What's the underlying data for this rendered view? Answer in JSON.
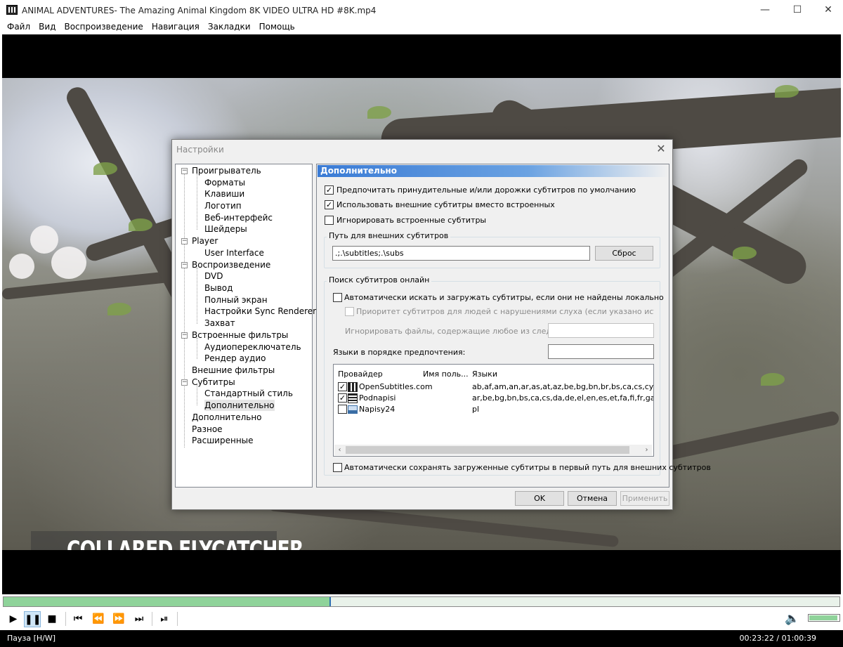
{
  "window": {
    "title": "ANIMAL ADVENTURES- The Amazing Animal Kingdom 8K VIDEO ULTRA HD #8K.mp4",
    "minimize": "—",
    "maximize": "☐",
    "close": "✕"
  },
  "menu": [
    "Файл",
    "Вид",
    "Воспроизведение",
    "Навигация",
    "Закладки",
    "Помощь"
  ],
  "video": {
    "caption": "COLLARED FLYCATCHER"
  },
  "dialog": {
    "title": "Настройки",
    "close": "✕",
    "tree": [
      {
        "label": "Проигрыватель",
        "level": 0,
        "expanded": true
      },
      {
        "label": "Форматы",
        "level": 1
      },
      {
        "label": "Клавиши",
        "level": 1
      },
      {
        "label": "Логотип",
        "level": 1
      },
      {
        "label": "Веб-интерфейс",
        "level": 1
      },
      {
        "label": "Шейдеры",
        "level": 1
      },
      {
        "label": "Player",
        "level": 0,
        "expanded": true
      },
      {
        "label": "User Interface",
        "level": 1
      },
      {
        "label": "Воспроизведение",
        "level": 0,
        "expanded": true
      },
      {
        "label": "DVD",
        "level": 1
      },
      {
        "label": "Вывод",
        "level": 1
      },
      {
        "label": "Полный экран",
        "level": 1
      },
      {
        "label": "Настройки Sync Renderer",
        "level": 1
      },
      {
        "label": "Захват",
        "level": 1
      },
      {
        "label": "Встроенные фильтры",
        "level": 0,
        "expanded": true
      },
      {
        "label": "Аудиопереключатель",
        "level": 1
      },
      {
        "label": "Рендер аудио",
        "level": 1
      },
      {
        "label": "Внешние фильтры",
        "level": 0
      },
      {
        "label": "Субтитры",
        "level": 0,
        "expanded": true
      },
      {
        "label": "Стандартный стиль",
        "level": 1
      },
      {
        "label": "Дополнительно",
        "level": 1,
        "selected": true
      },
      {
        "label": "Дополнительно",
        "level": 0
      },
      {
        "label": "Разное",
        "level": 0
      },
      {
        "label": "Расширенные",
        "level": 0
      }
    ],
    "panel": {
      "header": "Дополнительно",
      "opt_forced": "Предпочитать принудительные и/или дорожки субтитров по умолчанию",
      "opt_external": "Использовать внешние субтитры вместо встроенных",
      "opt_ignore_embedded": "Игнорировать встроенные субтитры",
      "path_group": "Путь для внешних субтитров",
      "path_value": ".;.\\subtitles;.\\subs",
      "reset": "Сброс",
      "online_group": "Поиск субтитров онлайн",
      "auto_search": "Автоматически искать и загружать субтитры, если они не найдены локально",
      "hearing_impaired": "Приоритет субтитров для людей с нарушениями слуха (если указано источником субтитро",
      "ignore_files": "Игнорировать файлы, содержащие любое из следующих",
      "languages": "Языки в порядке предпочтения:",
      "columns": [
        "Провайдер",
        "Имя поль...",
        "Языки"
      ],
      "providers": [
        {
          "name": "OpenSubtitles.com",
          "user": "",
          "langs": "ab,af,am,an,ar,as,at,az,be,bg,bn,br,bs,ca,cs,cy,da,de,ea,el",
          "checked": true,
          "icon": "opensubtitles-icon"
        },
        {
          "name": "Podnapisi",
          "user": "",
          "langs": "ar,be,bg,bn,bs,ca,cs,da,de,el,en,es,et,fa,fi,fr,ga,he,hi,hr,hu,",
          "checked": true,
          "icon": "film-icon"
        },
        {
          "name": "Napisy24",
          "user": "",
          "langs": "pl",
          "checked": false,
          "icon": "napisy-icon"
        }
      ],
      "auto_save": "Автоматически сохранять загруженные субтитры в первый путь для внешних субтитров"
    },
    "buttons": {
      "ok": "OK",
      "cancel": "Отмена",
      "apply": "Применить"
    }
  },
  "player": {
    "progress": 0.39,
    "volume": 0.95,
    "status_left": "Пауза [H/W]",
    "status_right": "00:23:22 / 01:00:39"
  }
}
